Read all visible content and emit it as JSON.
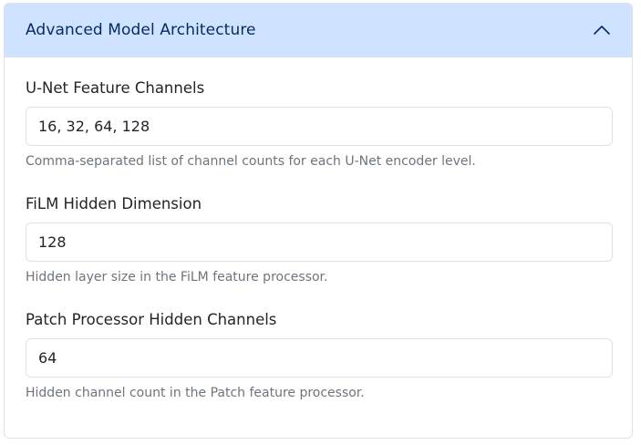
{
  "section": {
    "title": "Advanced Model Architecture",
    "expanded": true,
    "collapse_icon": "chevron-up-icon"
  },
  "fields": [
    {
      "label": "U-Net Feature Channels",
      "value": "16, 32, 64, 128",
      "help": "Comma-separated list of channel counts for each U-Net encoder level."
    },
    {
      "label": "FiLM Hidden Dimension",
      "value": "128",
      "help": "Hidden layer size in the FiLM feature processor."
    },
    {
      "label": "Patch Processor Hidden Channels",
      "value": "64",
      "help": "Hidden channel count in the Patch feature processor."
    }
  ],
  "colors": {
    "header_bg": "#cfe2ff",
    "header_text": "#052c65",
    "border": "#dee2e6",
    "help_text": "#6c757d"
  }
}
